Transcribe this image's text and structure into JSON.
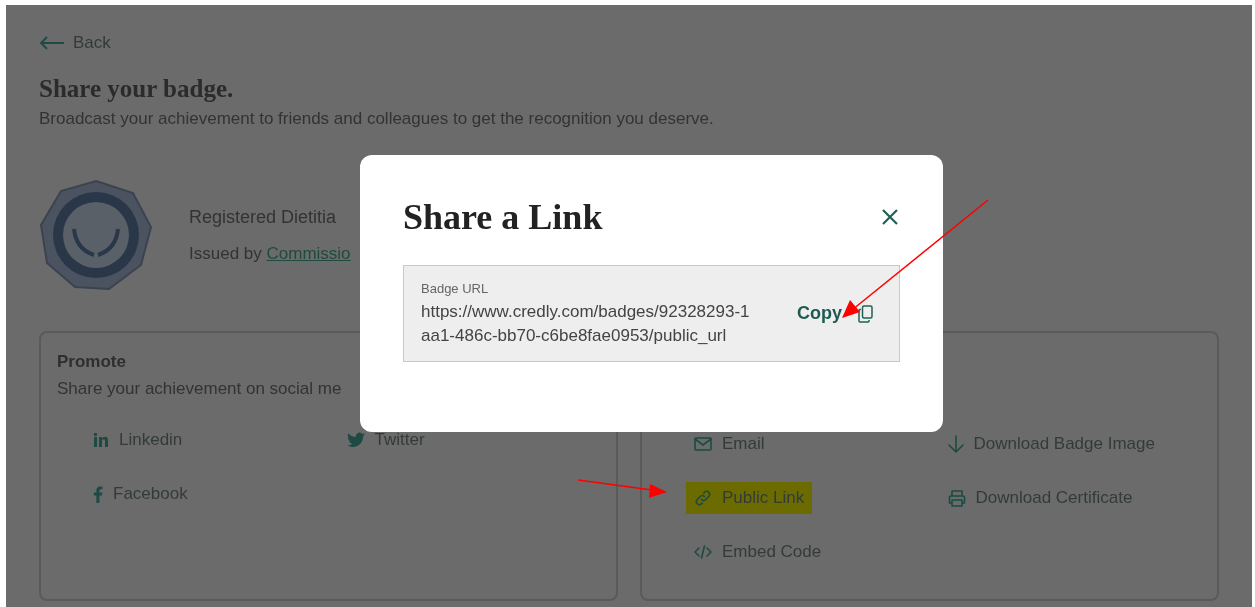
{
  "back": {
    "label": "Back"
  },
  "header": {
    "title": "Share your badge.",
    "subtitle": "Broadcast your achievement to friends and colleagues to get the recognition you deserve."
  },
  "badge": {
    "name": "Registered Dietitia",
    "issued_prefix": "Issued by",
    "issuer": "Commissio"
  },
  "cards": [
    {
      "title": "Promote",
      "description": "Share your achievement on social me",
      "items": [
        {
          "label": "Linkedin",
          "kind": "linkedin",
          "highlighted": false
        },
        {
          "label": "Twitter",
          "kind": "twitter",
          "highlighted": false
        },
        {
          "label": "Facebook",
          "kind": "facebook",
          "highlighted": false
        }
      ]
    },
    {
      "items": [
        {
          "label": "Email",
          "kind": "email",
          "highlighted": false
        },
        {
          "label": "Download Badge Image",
          "kind": "download",
          "highlighted": false
        },
        {
          "label": "Public Link",
          "kind": "link",
          "highlighted": true
        },
        {
          "label": "Download Certificate",
          "kind": "print",
          "highlighted": false
        },
        {
          "label": "Embed Code",
          "kind": "code",
          "highlighted": false
        }
      ]
    }
  ],
  "modal": {
    "title": "Share a Link",
    "field_label": "Badge URL",
    "url": "https://www.credly.com/badges/92328293-1aa1-486c-bb70-c6be8fae0953/public_url",
    "copy_label": "Copy"
  }
}
